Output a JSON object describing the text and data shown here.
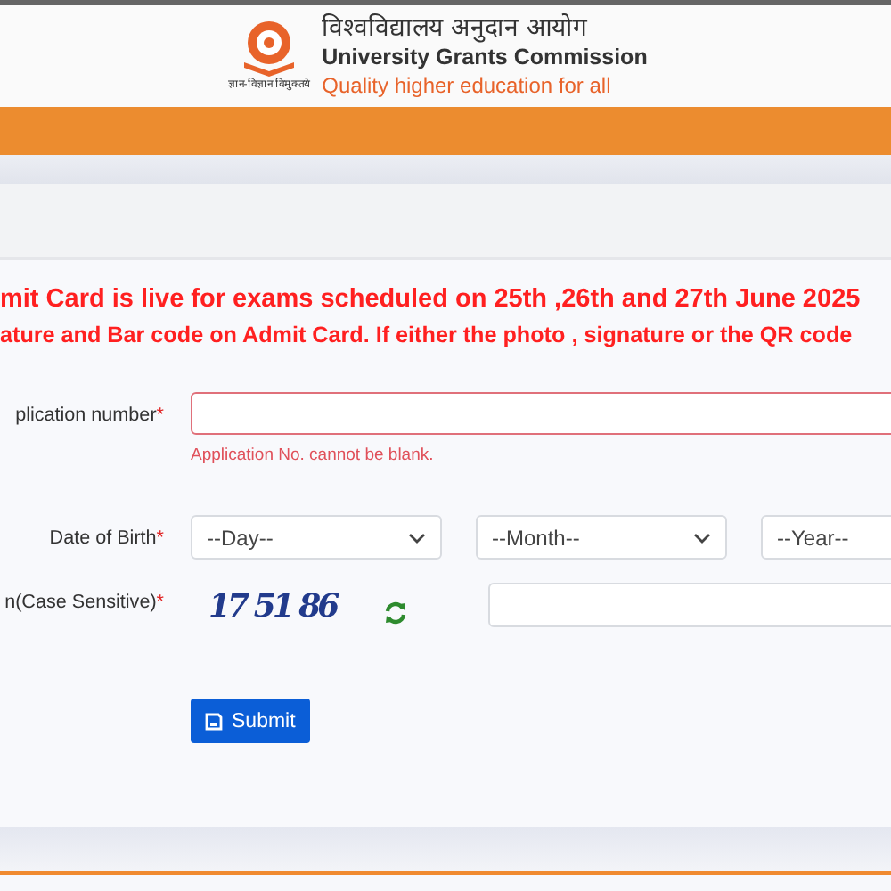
{
  "header": {
    "title_hindi": "विश्वविद्यालय अनुदान आयोग",
    "title": "University Grants Commission",
    "tagline": "Quality higher education for all",
    "motto": "ज्ञान-विज्ञान विमुक्तये"
  },
  "notice": [
    "mit Card is live for exams scheduled on 25th ,26th and 27th June 2025",
    "ature and Bar code on Admit Card. If either the photo , signature or the QR code"
  ],
  "form": {
    "application": {
      "label": "plication number",
      "required_mark": "*",
      "error": "Application No. cannot be blank."
    },
    "dob": {
      "label": "Date of Birth",
      "required_mark": "*",
      "selects": [
        "--Day--",
        "--Month--",
        "--Year--"
      ]
    },
    "captcha": {
      "label": "n(Case Sensitive)",
      "required_mark": "*",
      "code": "17 51 86"
    },
    "submit": "Submit"
  }
}
